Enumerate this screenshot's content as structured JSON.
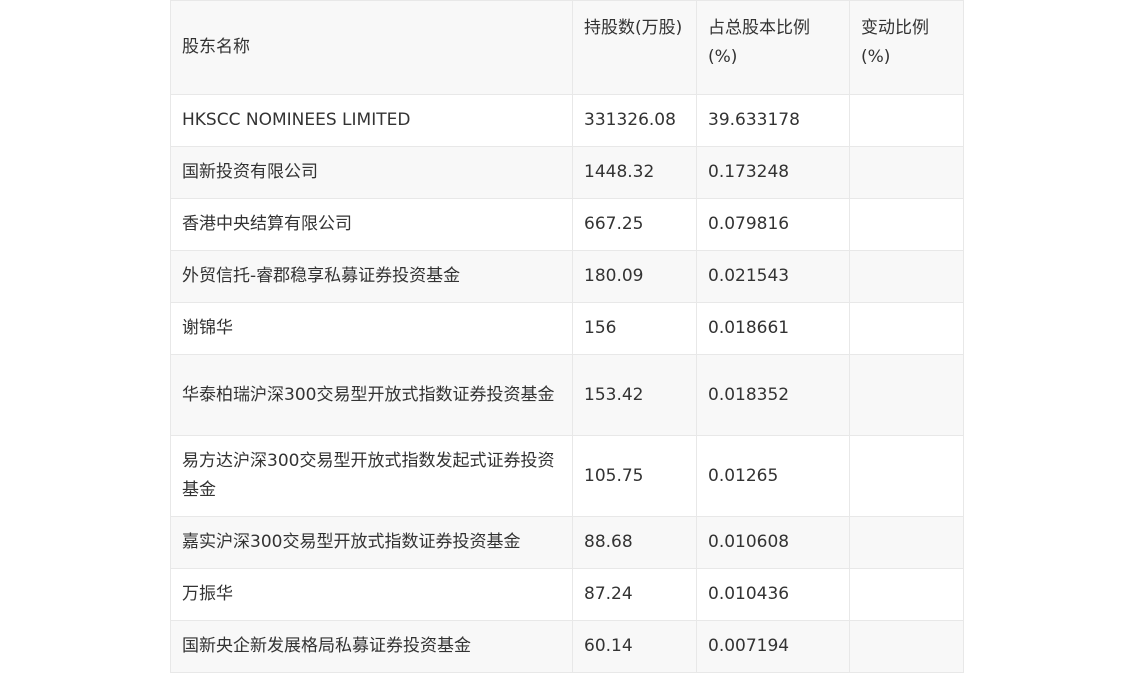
{
  "table": {
    "headers": [
      "股东名称",
      "持股数(万股)",
      "占总股本比例(%)",
      "变动比例(%)"
    ],
    "rows": [
      {
        "name": "HKSCC NOMINEES LIMITED",
        "shares": "331326.08",
        "ratio": "39.633178",
        "change": ""
      },
      {
        "name": "国新投资有限公司",
        "shares": "1448.32",
        "ratio": "0.173248",
        "change": ""
      },
      {
        "name": "香港中央结算有限公司",
        "shares": "667.25",
        "ratio": "0.079816",
        "change": ""
      },
      {
        "name": "外贸信托-睿郡稳享私募证券投资基金",
        "shares": "180.09",
        "ratio": "0.021543",
        "change": ""
      },
      {
        "name": "谢锦华",
        "shares": "156",
        "ratio": "0.018661",
        "change": ""
      },
      {
        "name": "华泰柏瑞沪深300交易型开放式指数证券投资基金",
        "shares": "153.42",
        "ratio": "0.018352",
        "change": ""
      },
      {
        "name": "易方达沪深300交易型开放式指数发起式证券投资基金",
        "shares": "105.75",
        "ratio": "0.01265",
        "change": ""
      },
      {
        "name": "嘉实沪深300交易型开放式指数证券投资基金",
        "shares": "88.68",
        "ratio": "0.010608",
        "change": ""
      },
      {
        "name": "万振华",
        "shares": "87.24",
        "ratio": "0.010436",
        "change": ""
      },
      {
        "name": "国新央企新发展格局私募证券投资基金",
        "shares": "60.14",
        "ratio": "0.007194",
        "change": ""
      }
    ]
  }
}
